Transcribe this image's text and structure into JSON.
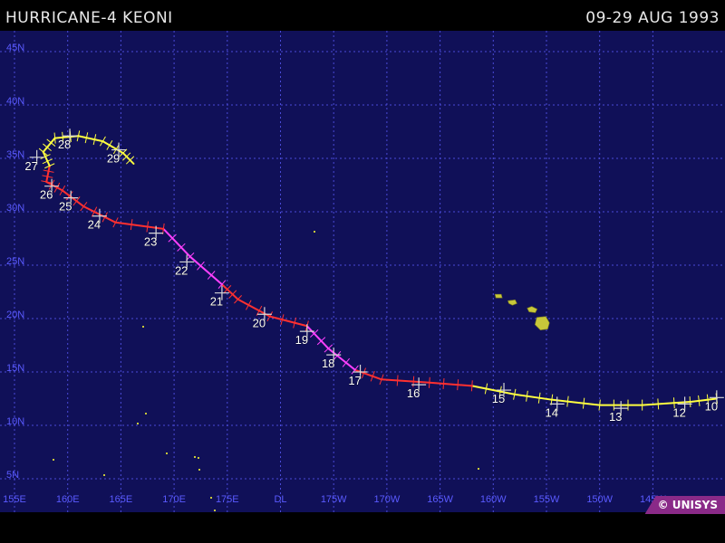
{
  "header": {
    "title": "HURRICANE-4 KEONI",
    "date_range": "09-29 AUG 1993"
  },
  "footer": {
    "copyright": "© UNISYS"
  },
  "colors": {
    "background": "#101058",
    "grid": "#4a4ad8",
    "labels": "#5a5aff",
    "land": "#c8c83a",
    "hurricane": "#ff3030",
    "typhoon": "#ff40ff",
    "storm": "#ffff40",
    "day_label": "#ffffff"
  },
  "map": {
    "lat_labels": [
      "45N",
      "40N",
      "35N",
      "30N",
      "25N",
      "20N",
      "15N",
      "10N",
      "5N"
    ],
    "lon_labels": [
      "155E",
      "160E",
      "165E",
      "170E",
      "175E",
      "DL",
      "175W",
      "170W",
      "165W",
      "160W",
      "155W",
      "150W",
      "145W"
    ],
    "lat_range": [
      3,
      47
    ],
    "lon_range_east": [
      155,
      222
    ]
  },
  "track": {
    "day_labels": [
      "10",
      "12",
      "13",
      "14",
      "15",
      "16",
      "17",
      "18",
      "19",
      "20",
      "21",
      "22",
      "23",
      "24",
      "25",
      "26",
      "27",
      "28",
      "29"
    ],
    "points": [
      {
        "lon": 221.0,
        "lat": 12.5,
        "cat": "storm"
      },
      {
        "lon": 218.5,
        "lat": 12.2,
        "cat": "storm"
      },
      {
        "lon": 214.0,
        "lat": 11.9,
        "cat": "storm"
      },
      {
        "lon": 210.0,
        "lat": 11.9,
        "cat": "storm"
      },
      {
        "lon": 205.5,
        "lat": 12.4,
        "cat": "storm"
      },
      {
        "lon": 202.0,
        "lat": 12.9,
        "cat": "storm"
      },
      {
        "lon": 198.0,
        "lat": 13.7,
        "cat": "hurricane"
      },
      {
        "lon": 194.0,
        "lat": 14.0,
        "cat": "hurricane"
      },
      {
        "lon": 189.5,
        "lat": 14.3,
        "cat": "hurricane"
      },
      {
        "lon": 187.0,
        "lat": 15.2,
        "cat": "typhoon"
      },
      {
        "lon": 184.5,
        "lat": 17.2,
        "cat": "typhoon"
      },
      {
        "lon": 182.5,
        "lat": 19.3,
        "cat": "hurricane"
      },
      {
        "lon": 179.0,
        "lat": 20.2,
        "cat": "hurricane"
      },
      {
        "lon": 176.0,
        "lat": 21.8,
        "cat": "hurricane"
      },
      {
        "lon": 174.5,
        "lat": 23.2,
        "cat": "typhoon"
      },
      {
        "lon": 171.5,
        "lat": 25.8,
        "cat": "typhoon"
      },
      {
        "lon": 169.0,
        "lat": 28.4,
        "cat": "hurricane"
      },
      {
        "lon": 164.5,
        "lat": 29.0,
        "cat": "hurricane"
      },
      {
        "lon": 161.5,
        "lat": 30.5,
        "cat": "hurricane"
      },
      {
        "lon": 159.5,
        "lat": 32.0,
        "cat": "hurricane"
      },
      {
        "lon": 158.0,
        "lat": 32.8,
        "cat": "hurricane"
      },
      {
        "lon": 158.3,
        "lat": 34.3,
        "cat": "storm"
      },
      {
        "lon": 157.7,
        "lat": 35.6,
        "cat": "storm"
      },
      {
        "lon": 158.8,
        "lat": 36.9,
        "cat": "storm"
      },
      {
        "lon": 161.0,
        "lat": 37.1,
        "cat": "storm"
      },
      {
        "lon": 163.3,
        "lat": 36.6,
        "cat": "storm"
      },
      {
        "lon": 165.2,
        "lat": 35.5,
        "cat": "storm"
      },
      {
        "lon": 166.2,
        "lat": 34.5,
        "cat": "storm"
      }
    ],
    "day_markers": [
      {
        "label": "10",
        "lon": 221.0,
        "lat": 12.6
      },
      {
        "label": "12",
        "lon": 218.0,
        "lat": 12.0
      },
      {
        "label": "13",
        "lon": 212.0,
        "lat": 11.6
      },
      {
        "label": "14",
        "lon": 206.0,
        "lat": 12.0
      },
      {
        "label": "15",
        "lon": 201.0,
        "lat": 13.3
      },
      {
        "label": "16",
        "lon": 193.0,
        "lat": 13.8
      },
      {
        "label": "17",
        "lon": 187.5,
        "lat": 15.0
      },
      {
        "label": "18",
        "lon": 185.0,
        "lat": 16.6
      },
      {
        "label": "19",
        "lon": 182.5,
        "lat": 18.8
      },
      {
        "label": "20",
        "lon": 178.5,
        "lat": 20.4
      },
      {
        "label": "21",
        "lon": 174.5,
        "lat": 22.4
      },
      {
        "label": "22",
        "lon": 171.2,
        "lat": 25.3
      },
      {
        "label": "23",
        "lon": 168.3,
        "lat": 28.0
      },
      {
        "label": "24",
        "lon": 163.0,
        "lat": 29.6
      },
      {
        "label": "25",
        "lon": 160.3,
        "lat": 31.3
      },
      {
        "label": "26",
        "lon": 158.5,
        "lat": 32.4
      },
      {
        "label": "27",
        "lon": 157.1,
        "lat": 35.1
      },
      {
        "label": "28",
        "lon": 160.2,
        "lat": 37.1
      },
      {
        "label": "29",
        "lon": 164.8,
        "lat": 35.8
      }
    ]
  },
  "land_features": [
    {
      "name": "hawaii-island",
      "lon": 204.6,
      "lat": 19.6
    },
    {
      "name": "maui",
      "lon": 203.7,
      "lat": 20.8
    },
    {
      "name": "oahu",
      "lon": 201.8,
      "lat": 21.5
    },
    {
      "name": "kauai",
      "lon": 200.5,
      "lat": 22.1
    }
  ]
}
